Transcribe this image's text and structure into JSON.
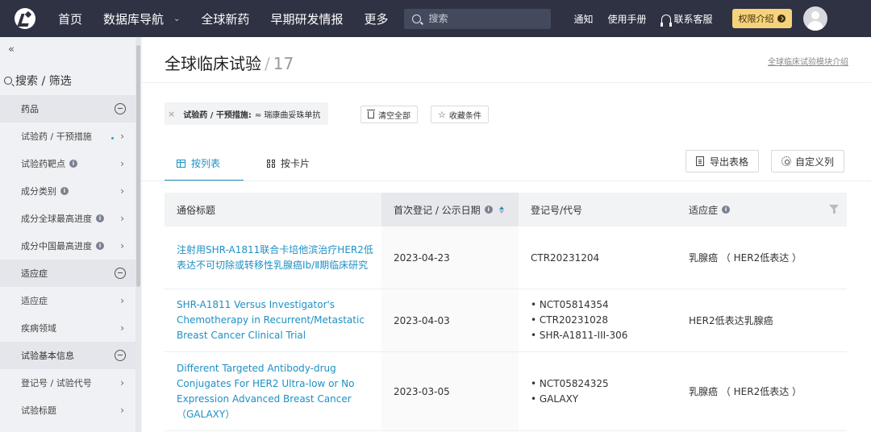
{
  "nav": {
    "items": [
      "首页",
      "数据库导航",
      "全球新药",
      "早期研发情报",
      "更多"
    ],
    "search_placeholder": "搜索",
    "notify": "通知",
    "manual": "使用手册",
    "support": "联系客服",
    "permission": "权限介绍"
  },
  "sidebar": {
    "collapse": "«",
    "search_label": "搜索 / 筛选",
    "groups": [
      {
        "title": "药品",
        "items": [
          "试验药 / 干预措施",
          "试验药靶点",
          "成分类别",
          "成分全球最高进度",
          "成分中国最高进度"
        ]
      },
      {
        "title": "适应症",
        "items": [
          "适应症",
          "疾病领域"
        ]
      },
      {
        "title": "试验基本信息",
        "items": [
          "登记号 / 试验代号",
          "试验标题"
        ]
      }
    ]
  },
  "page": {
    "title": "全球临床试验",
    "separator": "/",
    "count": "17",
    "intro_link": "全球临床试验模块介绍"
  },
  "filter": {
    "close": "×",
    "key": "试验药 / 干预措施:",
    "value": "≈ 瑞康曲妥珠单抗",
    "clear_all": "清空全部",
    "save_condition": "收藏条件"
  },
  "tabs": {
    "list": "按列表",
    "card": "按卡片"
  },
  "actions": {
    "export": "导出表格",
    "custom_columns": "自定义列"
  },
  "table": {
    "headers": [
      "通俗标题",
      "首次登记 / 公示日期",
      "登记号/代号",
      "适应症"
    ],
    "rows": [
      {
        "title": "注射用SHR-A1811联合卡培他滨治疗HER2低表达不可切除或转移性乳腺癌Ⅰb/Ⅱ期临床研究",
        "date": "2023-04-23",
        "reg": [
          "CTR20231204"
        ],
        "indication": "乳腺癌 （ HER2低表达 ）"
      },
      {
        "title": "SHR-A1811 Versus Investigator's Chemotherapy in Recurrent/Metastatic Breast Cancer Clinical Trial",
        "date": "2023-04-03",
        "reg": [
          "NCT05814354",
          "CTR20231028",
          "SHR-A1811-III-306"
        ],
        "indication": "HER2低表达乳腺癌"
      },
      {
        "title": "Different Targeted Antibody-drug Conjugates For HER2 Ultra-low or No Expression Advanced Breast Cancer （GALAXY）",
        "date": "2023-03-05",
        "reg": [
          "NCT05824325",
          "GALAXY"
        ],
        "indication": "乳腺癌 （ HER2低表达 ）"
      }
    ]
  }
}
